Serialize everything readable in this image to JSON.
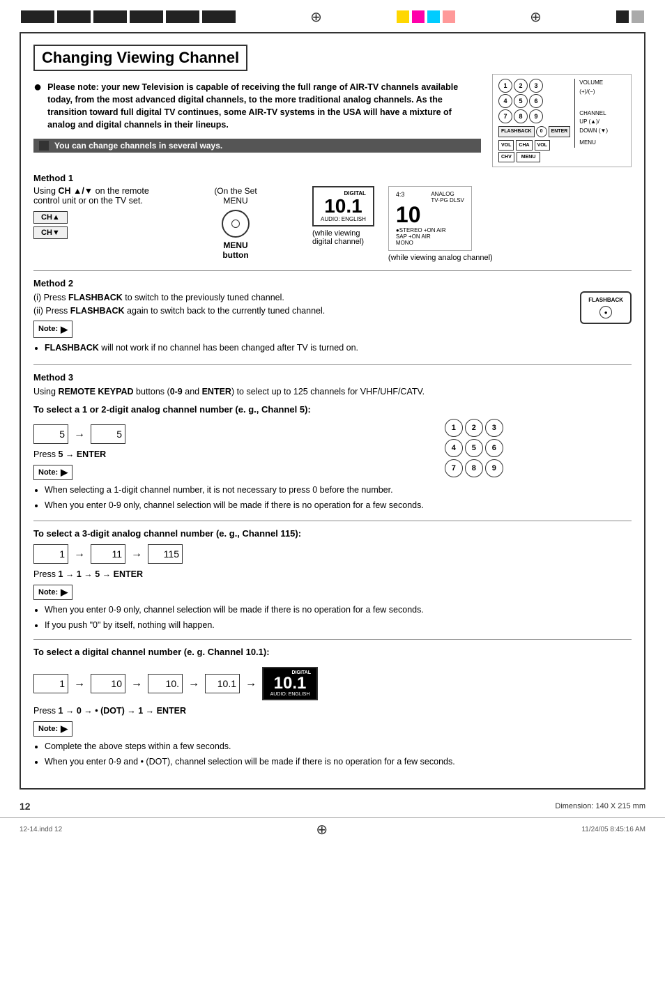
{
  "page": {
    "title": "Changing Viewing Channel",
    "page_number": "12",
    "dimension": "Dimension: 140  X 215 mm",
    "footer_left": "12-14.indd  12",
    "footer_right": "11/24/05  8:45:16 AM"
  },
  "remote_diagram": {
    "numbers": [
      "1",
      "2",
      "3",
      "4",
      "5",
      "6",
      "7",
      "8",
      "9"
    ],
    "volume_label": "VOLUME",
    "volume_keys": "(+)/(-)",
    "channel_label": "CHANNEL",
    "channel_up": "UP (▲)/",
    "channel_down": "DOWN (▼)",
    "menu_label": "MENU",
    "flashback_label": "FLASHBACK",
    "enter_label": "ENTER",
    "vol_label": "VOL",
    "ch_up_label": "CHA",
    "ch_dn_label": "CHV"
  },
  "bullet1": {
    "text": "Please note: your new Television is capable of receiving the full range of AIR-TV channels available today, from the most advanced digital channels, to the more traditional analog channels. As the transition toward full digital TV continues, some AIR-TV systems in the USA will have a mixture of analog and digital channels in their lineups."
  },
  "gray_note": {
    "text": "You can change channels in several ways."
  },
  "method1": {
    "title": "Method 1",
    "description": "Using CH ▲/▼ on the remote control unit or on the TV set.",
    "on_set": "(On  the  Set",
    "menu": "MENU",
    "menu_button": "MENU\nbutton",
    "while_digital": "(while viewing\ndigital channel)",
    "while_analog": "(while viewing  analog channel)"
  },
  "method2": {
    "title": "Method 2",
    "line1": "(i)  Press FLASHBACK to switch to the previously tuned channel.",
    "line2": "(ii) Press FLASHBACK again to switch back to the currently tuned channel.",
    "note_label": "Note:",
    "bullet1": "FLASHBACK will not work if no channel has been changed after TV is turned on."
  },
  "method3": {
    "title": "Method 3",
    "description": "Using REMOTE KEYPAD buttons (0-9 and ENTER) to select up to 125 channels for VHF/UHF/CATV.",
    "section1_title": "To select a 1 or 2-digit analog channel number (e. g., Channel 5):",
    "section1_example": "5",
    "section1_result": "5",
    "section1_press": "Press 5 → ENTER",
    "section1_note": "Note:",
    "section1_bullets": [
      "When selecting a 1-digit channel number, it is not necessary to press 0 before the number.",
      "When you enter 0-9 only, channel selection will be made if there is no operation for a few seconds."
    ],
    "section2_title": "To select a 3-digit analog channel number (e. g., Channel 115):",
    "section2_steps": [
      "1",
      "11",
      "115"
    ],
    "section2_press": "Press 1 → 1 → 5 → ENTER",
    "section2_note": "Note:",
    "section2_bullets": [
      "When you enter 0-9 only, channel selection will be made if there is no operation for a few seconds.",
      "If you push \"0\" by itself, nothing will happen."
    ],
    "section3_title": "To select a digital channel number (e. g. Channel 10.1):",
    "section3_steps": [
      "1",
      "10",
      "10.",
      "10.1"
    ],
    "section3_press": "Press 1 → 0 → • (DOT) → 1 → ENTER",
    "section3_note": "Note:",
    "section3_bullets": [
      "Complete the above steps within a few seconds.",
      "When you enter 0-9 and • (DOT), channel selection will be made if there is no operation for a few seconds."
    ],
    "digital_channel": "10.1",
    "digital_label": "DIGITAL",
    "digital_sublabel": "AUDIO: ENGLISH"
  },
  "analog_display": {
    "number": "10",
    "ratio": "4:3",
    "rating": "ANALOG\nTV·PG  DLSV",
    "stereo": "●STEREO   +ON  AIR",
    "sap": "SAP      +ON  AIR",
    "mono": "MONO"
  },
  "digital_display": {
    "number": "10.1",
    "label": "DIGITAL",
    "sublabel": "AUDIO: ENGLISH"
  },
  "colors": {
    "yellow": "#FFD700",
    "magenta": "#FF00AA",
    "cyan": "#00CCFF",
    "pink": "#FF9999",
    "green": "#00CC00",
    "red": "#FF0000",
    "blue": "#0000FF"
  }
}
